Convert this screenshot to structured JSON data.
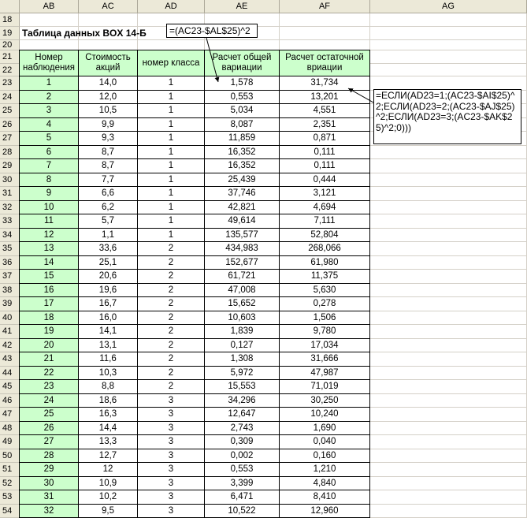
{
  "columns": [
    "AB",
    "AC",
    "AD",
    "AE",
    "AF",
    "AG"
  ],
  "title": "Таблица данных BOX 14-Б",
  "headers": {
    "ab": "Номер наблюдения",
    "ac": "Стоимость акций",
    "ad": "номер класса",
    "ae": "Расчет общей вариации",
    "af": "Расчет остаточной вриации"
  },
  "callouts": {
    "formula1": "=(AC23-$AL$25)^2",
    "formula2": "=ЕСЛИ(AD23=1;(AC23-$AI$25)^2;ЕСЛИ(AD23=2;(AC23-$AJ$25)^2;ЕСЛИ(AD23=3;(AC23-$AK$25)^2;0)))"
  },
  "row_numbers": [
    "18",
    "19",
    "20",
    "21",
    "22",
    "23",
    "24",
    "25",
    "26",
    "27",
    "28",
    "29",
    "30",
    "31",
    "32",
    "33",
    "34",
    "35",
    "36",
    "37",
    "38",
    "39",
    "40",
    "41",
    "42",
    "43",
    "44",
    "45",
    "46",
    "47",
    "48",
    "49",
    "50",
    "51",
    "52",
    "53",
    "54"
  ],
  "rows": [
    [
      "1",
      "14,0",
      "1",
      "1,578",
      "31,734"
    ],
    [
      "2",
      "12,0",
      "1",
      "0,553",
      "13,201"
    ],
    [
      "3",
      "10,5",
      "1",
      "5,034",
      "4,551"
    ],
    [
      "4",
      "9,9",
      "1",
      "8,087",
      "2,351"
    ],
    [
      "5",
      "9,3",
      "1",
      "11,859",
      "0,871"
    ],
    [
      "6",
      "8,7",
      "1",
      "16,352",
      "0,111"
    ],
    [
      "7",
      "8,7",
      "1",
      "16,352",
      "0,111"
    ],
    [
      "8",
      "7,7",
      "1",
      "25,439",
      "0,444"
    ],
    [
      "9",
      "6,6",
      "1",
      "37,746",
      "3,121"
    ],
    [
      "10",
      "6,2",
      "1",
      "42,821",
      "4,694"
    ],
    [
      "11",
      "5,7",
      "1",
      "49,614",
      "7,111"
    ],
    [
      "12",
      "1,1",
      "1",
      "135,577",
      "52,804"
    ],
    [
      "13",
      "33,6",
      "2",
      "434,983",
      "268,066"
    ],
    [
      "14",
      "25,1",
      "2",
      "152,677",
      "61,980"
    ],
    [
      "15",
      "20,6",
      "2",
      "61,721",
      "11,375"
    ],
    [
      "16",
      "19,6",
      "2",
      "47,008",
      "5,630"
    ],
    [
      "17",
      "16,7",
      "2",
      "15,652",
      "0,278"
    ],
    [
      "18",
      "16,0",
      "2",
      "10,603",
      "1,506"
    ],
    [
      "19",
      "14,1",
      "2",
      "1,839",
      "9,780"
    ],
    [
      "20",
      "13,1",
      "2",
      "0,127",
      "17,034"
    ],
    [
      "21",
      "11,6",
      "2",
      "1,308",
      "31,666"
    ],
    [
      "22",
      "10,3",
      "2",
      "5,972",
      "47,987"
    ],
    [
      "23",
      "8,8",
      "2",
      "15,553",
      "71,019"
    ],
    [
      "24",
      "18,6",
      "3",
      "34,296",
      "30,250"
    ],
    [
      "25",
      "16,3",
      "3",
      "12,647",
      "10,240"
    ],
    [
      "26",
      "14,4",
      "3",
      "2,743",
      "1,690"
    ],
    [
      "27",
      "13,3",
      "3",
      "0,309",
      "0,040"
    ],
    [
      "28",
      "12,7",
      "3",
      "0,002",
      "0,160"
    ],
    [
      "29",
      "12",
      "3",
      "0,553",
      "1,210"
    ],
    [
      "30",
      "10,9",
      "3",
      "3,399",
      "4,840"
    ],
    [
      "31",
      "10,2",
      "3",
      "6,471",
      "8,410"
    ],
    [
      "32",
      "9,5",
      "3",
      "10,522",
      "12,960"
    ]
  ]
}
